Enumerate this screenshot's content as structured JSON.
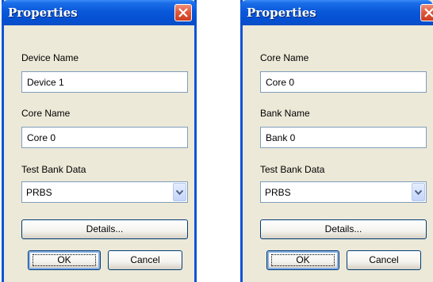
{
  "dialogs": [
    {
      "title": "Properties",
      "field1": {
        "label": "Device Name",
        "value": "Device 1"
      },
      "field2": {
        "label": "Core Name",
        "value": "Core 0"
      },
      "select": {
        "label": "Test Bank Data",
        "value": "PRBS"
      },
      "details_label": "Details...",
      "ok_label": "OK",
      "cancel_label": "Cancel"
    },
    {
      "title": "Properties",
      "field1": {
        "label": "Core Name",
        "value": "Core 0"
      },
      "field2": {
        "label": "Bank Name",
        "value": "Bank 0"
      },
      "select": {
        "label": "Test Bank Data",
        "value": "PRBS"
      },
      "details_label": "Details...",
      "ok_label": "OK",
      "cancel_label": "Cancel"
    }
  ],
  "colors": {
    "title_bar": "#0a58da",
    "close_button": "#e2593b",
    "dialog_body": "#ece9d8"
  },
  "icons": {
    "close": "close-icon",
    "dropdown": "chevron-down-icon"
  }
}
